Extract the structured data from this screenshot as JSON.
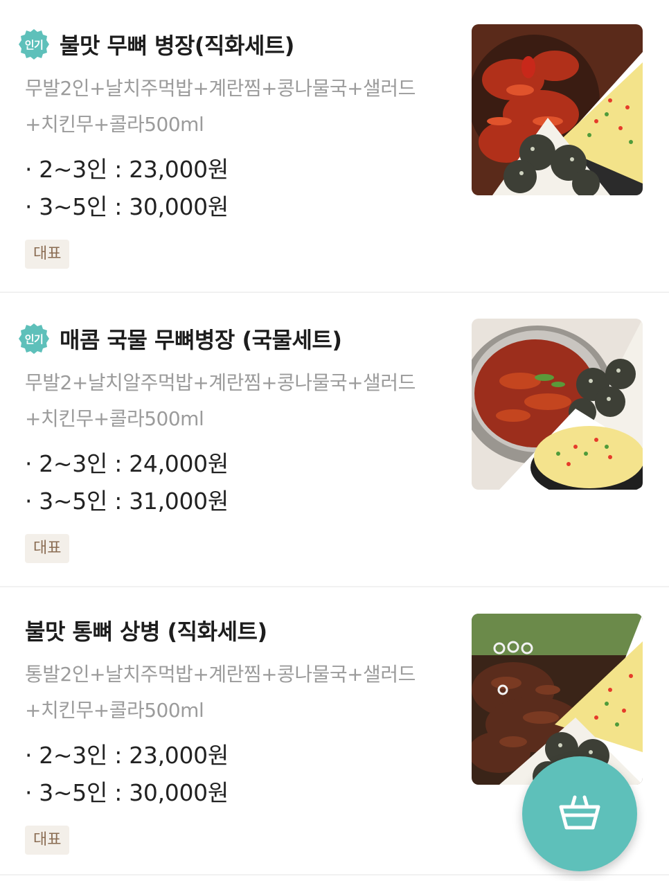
{
  "colors": {
    "accent": "#5ec0ba",
    "title": "#1d1d1d",
    "description": "#9b9b9b",
    "tag_bg": "#f3efe9",
    "tag_text": "#8a6c52",
    "divider": "#f1f1f1"
  },
  "menu": {
    "items": [
      {
        "badge": "인기",
        "title": "불맛 무뼈 병장(직화세트)",
        "description_line1": "무발2인+날치주먹밥+계란찜+콩나물국+샐러드",
        "description_line2": "+치킨무+콜라500ml",
        "prices": [
          {
            "bullet": "·",
            "label": "2~3인 : 23,000원"
          },
          {
            "bullet": "·",
            "label": "3~5인 : 30,000원"
          }
        ],
        "tag": "대표",
        "image_icon": "spicy-boneless-chicken-feet-set-photo"
      },
      {
        "badge": "인기",
        "title": "매콤 국물 무뼈병장 (국물세트)",
        "description_line1": "무발2+날치알주먹밥+계란찜+콩나물국+샐러드",
        "description_line2": "+치킨무+콜라500ml",
        "prices": [
          {
            "bullet": "·",
            "label": "2~3인 : 24,000원"
          },
          {
            "bullet": "·",
            "label": "3~5인 : 31,000원"
          }
        ],
        "tag": "대표",
        "image_icon": "spicy-soup-chicken-feet-set-photo"
      },
      {
        "badge": "",
        "title": "불맛 통뼈 상병 (직화세트)",
        "description_line1": "통발2인+날치주먹밥+계란찜+콩나물국+샐러드",
        "description_line2": "+치킨무+콜라500ml",
        "prices": [
          {
            "bullet": "·",
            "label": "2~3인 : 23,000원"
          },
          {
            "bullet": "·",
            "label": "3~5인 : 30,000원"
          }
        ],
        "tag": "대표",
        "image_icon": "bone-in-chicken-feet-set-photo"
      }
    ]
  },
  "cart_button": {
    "icon": "shopping-basket-icon"
  }
}
